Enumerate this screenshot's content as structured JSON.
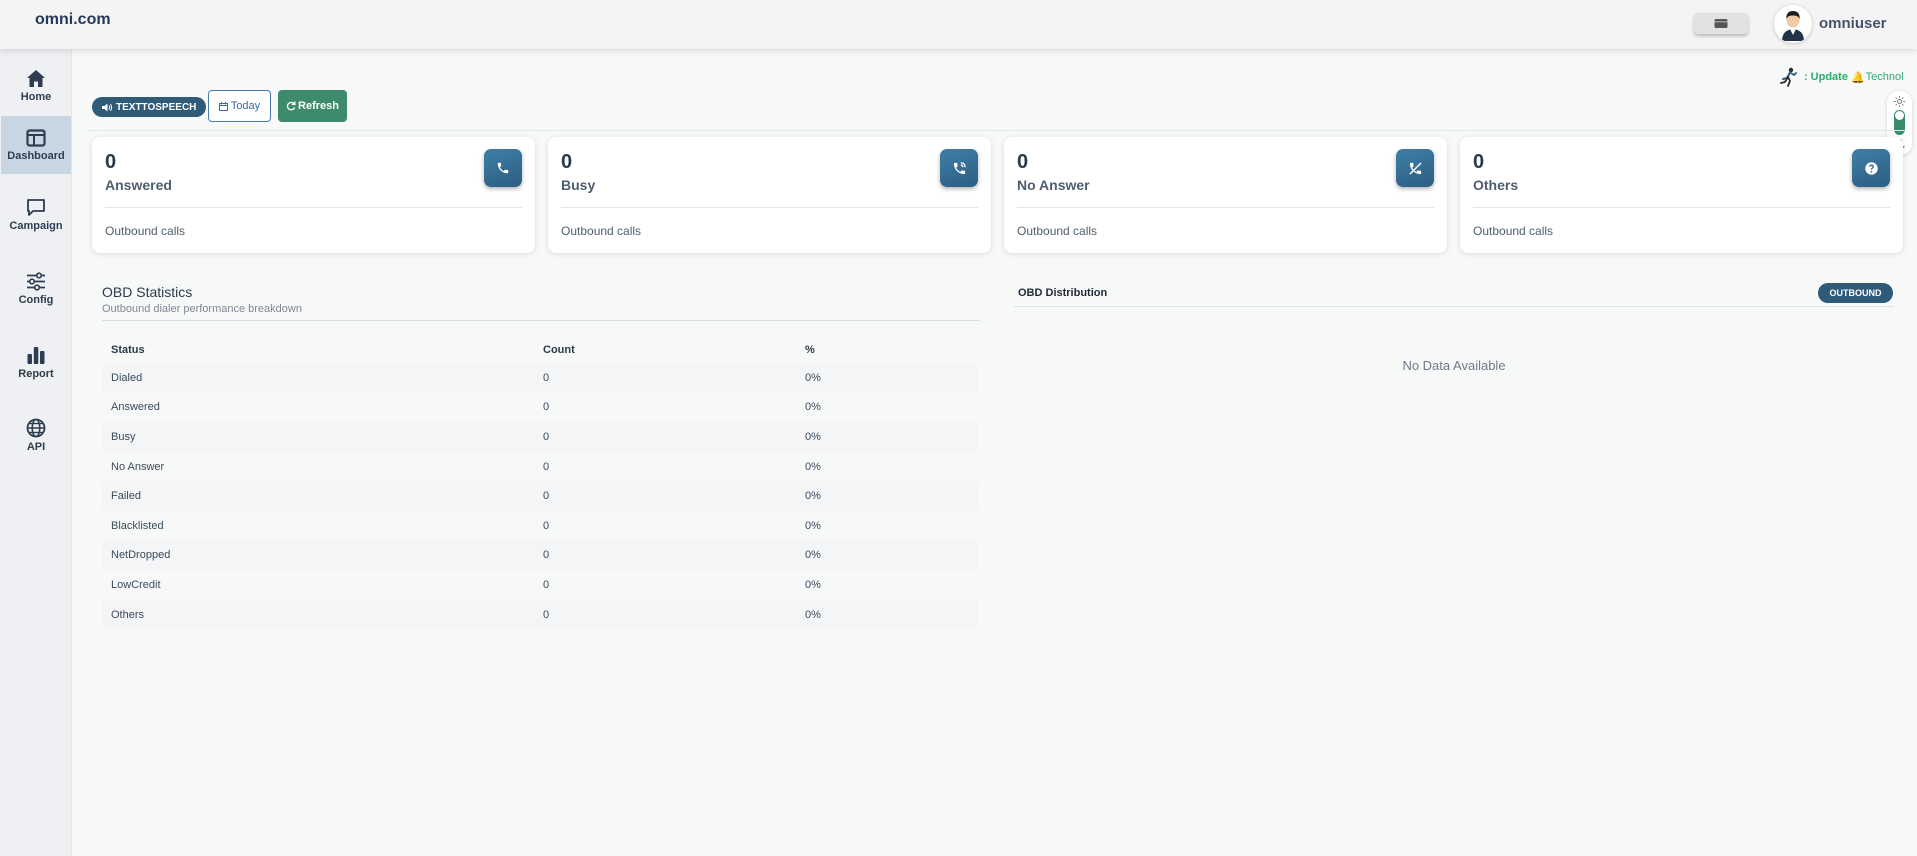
{
  "header": {
    "brand": "omni.com",
    "username": "omniuser"
  },
  "sidebar": {
    "items": [
      {
        "label": "Home",
        "icon": "home-icon"
      },
      {
        "label": "Dashboard",
        "icon": "dashboard-icon",
        "active": true
      },
      {
        "label": "Campaign",
        "icon": "chat-icon"
      },
      {
        "label": "Config",
        "icon": "sliders-icon"
      },
      {
        "label": "Report",
        "icon": "bar-chart-icon"
      },
      {
        "label": "API",
        "icon": "globe-icon"
      }
    ]
  },
  "toolbar": {
    "tts_label": "TEXTTOSPEECH",
    "today_label": "Today",
    "refresh_label": "Refresh"
  },
  "ticker": {
    "prefix": ":",
    "update": "Update",
    "text": "Technol"
  },
  "cards": [
    {
      "value": "0",
      "label": "Answered",
      "footer": "Outbound calls",
      "icon": "phone-icon"
    },
    {
      "value": "0",
      "label": "Busy",
      "footer": "Outbound calls",
      "icon": "phone-busy-icon"
    },
    {
      "value": "0",
      "label": "No Answer",
      "footer": "Outbound calls",
      "icon": "phone-missed-icon"
    },
    {
      "value": "0",
      "label": "Others",
      "footer": "Outbound calls",
      "icon": "question-icon"
    }
  ],
  "stats": {
    "title": "OBD Statistics",
    "subtitle": "Outbound dialer performance breakdown",
    "headers": [
      "Status",
      "Count",
      "%"
    ],
    "rows": [
      [
        "Dialed",
        "0",
        "0%"
      ],
      [
        "Answered",
        "0",
        "0%"
      ],
      [
        "Busy",
        "0",
        "0%"
      ],
      [
        "No Answer",
        "0",
        "0%"
      ],
      [
        "Failed",
        "0",
        "0%"
      ],
      [
        "Blacklisted",
        "0",
        "0%"
      ],
      [
        "NetDropped",
        "0",
        "0%"
      ],
      [
        "LowCredit",
        "0",
        "0%"
      ],
      [
        "Others",
        "0",
        "0%"
      ]
    ]
  },
  "distribution": {
    "title": "OBD Distribution",
    "badge": "OUTBOUND",
    "empty": "No Data Available"
  },
  "colors": {
    "primary": "#2f5a78",
    "success": "#3e8a6c",
    "ticker": "#2aab6e"
  }
}
